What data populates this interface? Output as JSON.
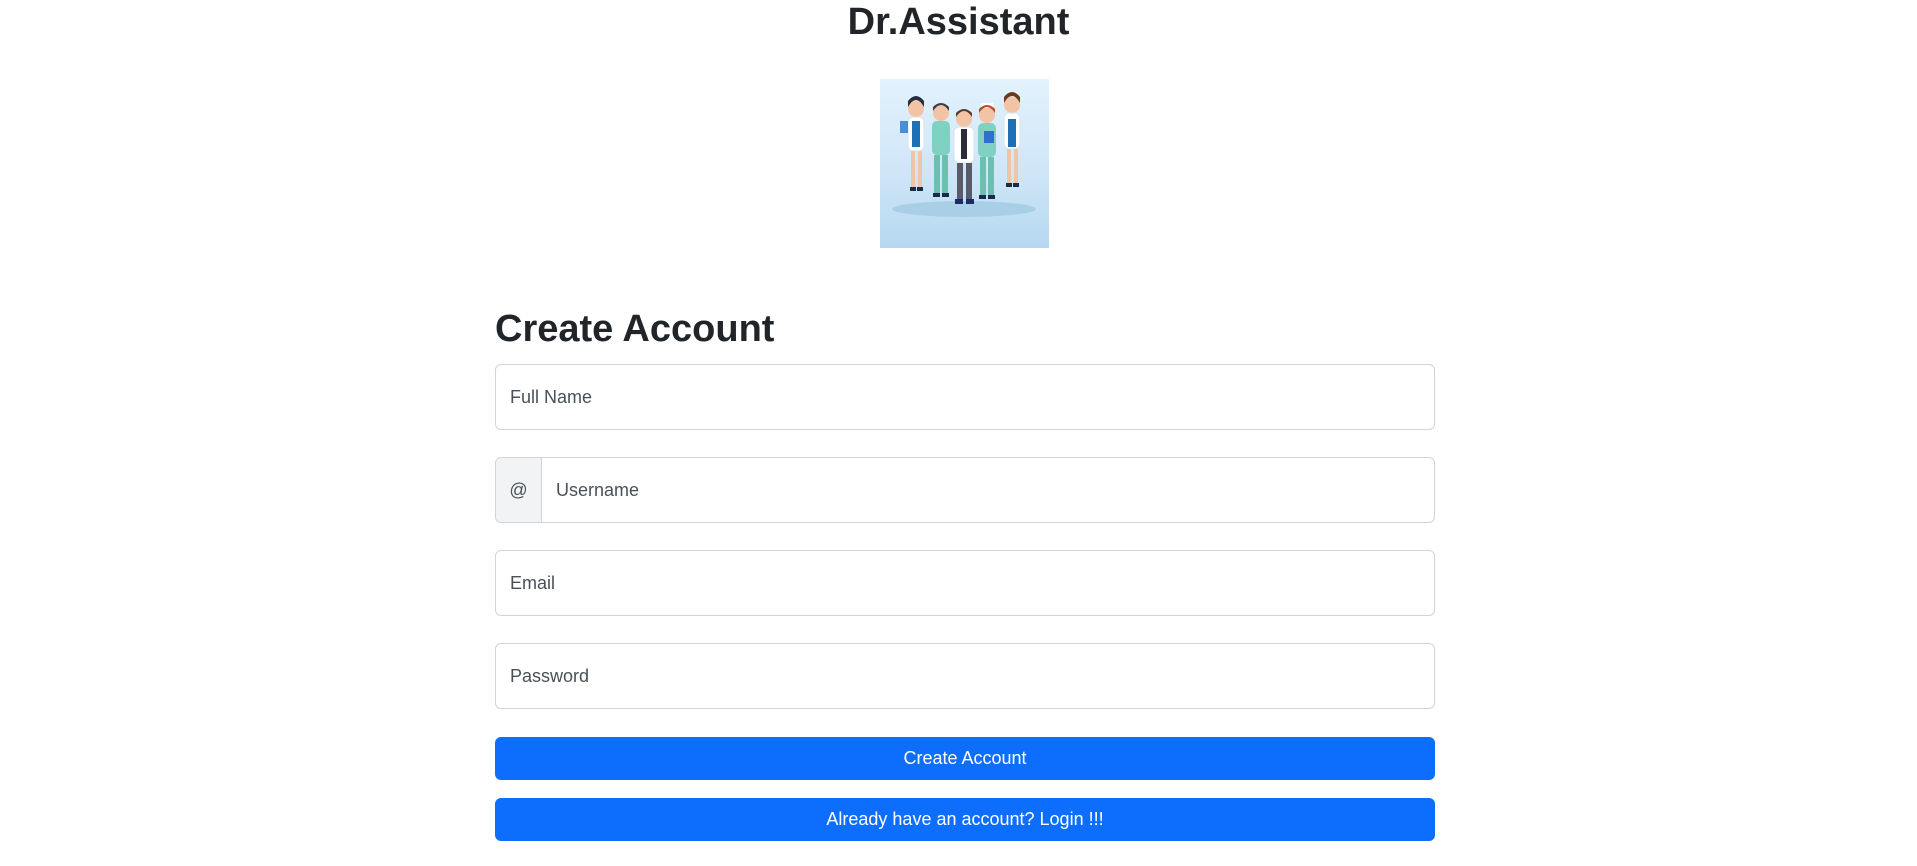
{
  "app": {
    "title": "Dr.Assistant"
  },
  "hero": {
    "image": "medical-team-illustration"
  },
  "form": {
    "heading": "Create Account",
    "fields": {
      "full_name": {
        "placeholder": "Full Name",
        "value": ""
      },
      "username": {
        "prefix": "@",
        "placeholder": "Username",
        "value": ""
      },
      "email": {
        "placeholder": "Email",
        "value": ""
      },
      "password": {
        "placeholder": "Password",
        "value": ""
      }
    },
    "buttons": {
      "create_account": "Create Account",
      "login": "Already have an account? Login !!!"
    }
  },
  "colors": {
    "primary": "#0d6efd",
    "border": "#ced4da",
    "addon_bg": "#f1f3f5",
    "text": "#212529"
  }
}
